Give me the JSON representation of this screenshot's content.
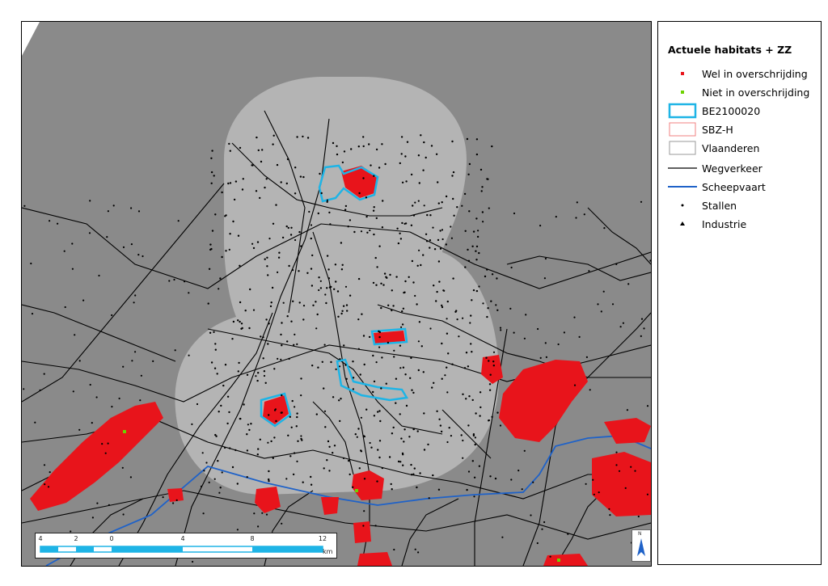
{
  "legend": {
    "title": "Actuele habitats + ZZ",
    "items": [
      {
        "key": "wel",
        "label": "Wel in overschrijding",
        "color": "#e8141b",
        "icon": "red-dot"
      },
      {
        "key": "niet",
        "label": "Niet in overschrijding",
        "color": "#6dd200",
        "icon": "green-dot"
      },
      {
        "key": "be",
        "label": "BE2100020",
        "color": "#1eb4e6",
        "icon": "cyan-outline-box"
      },
      {
        "key": "sbz",
        "label": "SBZ-H",
        "color": "#f08080",
        "icon": "pink-outline-box"
      },
      {
        "key": "vl",
        "label": "Vlaanderen",
        "color": "#999999",
        "icon": "grey-outline-box"
      },
      {
        "key": "weg",
        "label": "Wegverkeer",
        "color": "#000000",
        "icon": "black-line"
      },
      {
        "key": "scheep",
        "label": "Scheepvaart",
        "color": "#1f62c8",
        "icon": "blue-line"
      },
      {
        "key": "stallen",
        "label": "Stallen",
        "color": "#000000",
        "icon": "small-dot"
      },
      {
        "key": "industrie",
        "label": "Industrie",
        "color": "#000000",
        "icon": "small-triangle"
      }
    ]
  },
  "scalebar": {
    "ticks": [
      "4",
      "2",
      "0",
      "4",
      "8",
      "12"
    ],
    "unit": "km"
  },
  "north_arrow": {
    "label": "N"
  },
  "colors": {
    "outside": "#8a8a8a",
    "zone": "#b4b4b4",
    "road": "#000000",
    "waterway": "#1f62c8",
    "exceed": "#e8141b",
    "not_exceed": "#6dd200",
    "be_outline": "#1eb4e6"
  }
}
